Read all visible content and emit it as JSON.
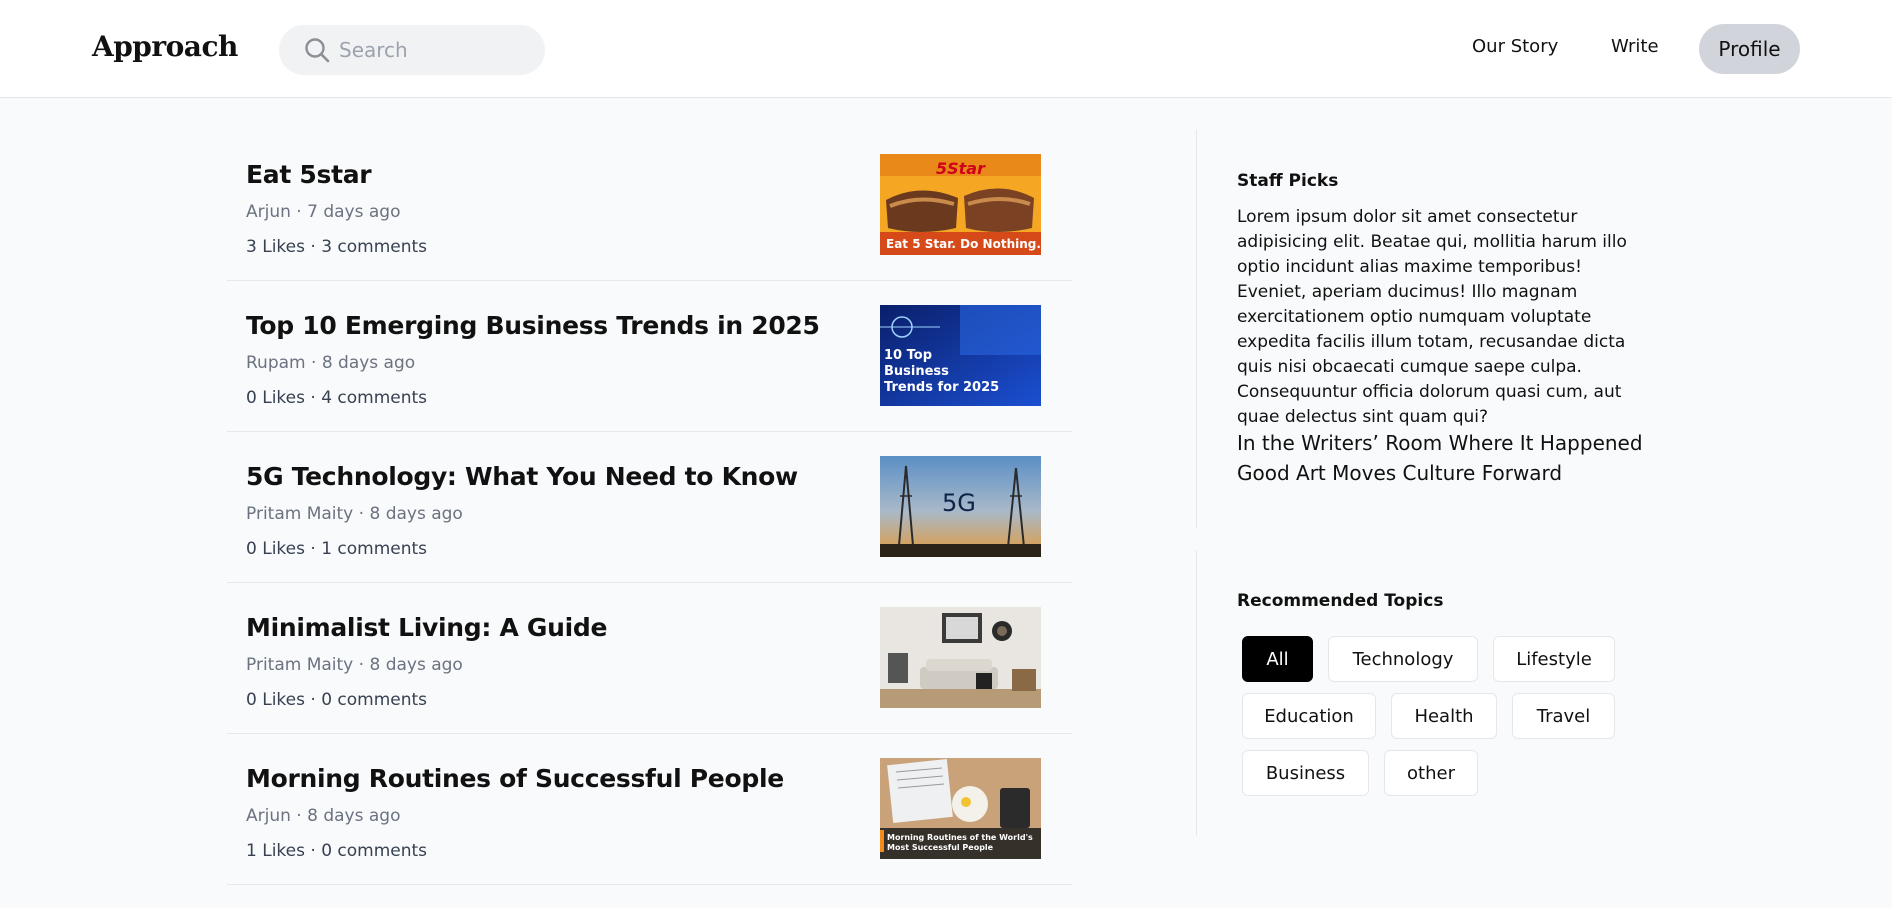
{
  "header": {
    "logo": "Approach",
    "search_placeholder": "Search",
    "nav": {
      "our_story": "Our Story",
      "write": "Write",
      "profile": "Profile"
    }
  },
  "articles": [
    {
      "title": "Eat 5star",
      "author": "Arjun",
      "time": "7 days ago",
      "likes": "3 Likes",
      "comments": "3 comments",
      "thumb_text": [
        "5Star",
        "Eat 5 Star. Do Nothing."
      ]
    },
    {
      "title": "Top 10 Emerging Business Trends in 2025",
      "author": "Rupam",
      "time": "8 days ago",
      "likes": "0 Likes",
      "comments": "4 comments",
      "thumb_text": [
        "10 Top",
        "Business",
        "Trends for 2025"
      ]
    },
    {
      "title": "5G Technology: What You Need to Know",
      "author": "Pritam Maity",
      "time": "8 days ago",
      "likes": "0 Likes",
      "comments": "1 comments",
      "thumb_text": [
        "5G"
      ]
    },
    {
      "title": "Minimalist Living: A Guide",
      "author": "Pritam Maity",
      "time": "8 days ago",
      "likes": "0 Likes",
      "comments": "0 comments",
      "thumb_text": []
    },
    {
      "title": "Morning Routines of Successful People",
      "author": "Arjun",
      "time": "8 days ago",
      "likes": "1 Likes",
      "comments": "0 comments",
      "thumb_text": [
        "Morning Routines of the World's",
        "Most Successful People"
      ]
    }
  ],
  "sidebar": {
    "staff_picks": {
      "heading": "Staff Picks",
      "text": "Lorem ipsum dolor sit amet consectetur adipisicing elit. Beatae qui, mollitia harum illo optio incidunt alias maxime temporibus! Eveniet, aperiam ducimus! Illo magnam exercitationem optio numquam voluptate expedita facilis illum totam, recusandae dicta quis nisi obcaecati cumque saepe culpa. Consequuntur officia dolorum quasi cum, aut quae delectus sint quam qui?",
      "links": [
        "In the Writers’ Room Where It Happened",
        "Good Art Moves Culture Forward"
      ]
    },
    "recommended_topics": {
      "heading": "Recommended Topics",
      "topics": [
        "All",
        "Technology",
        "Lifestyle",
        "Education",
        "Health",
        "Travel",
        "Business",
        "other"
      ],
      "selected": "All"
    }
  },
  "colors": {
    "page_bg": "#f9fafb",
    "header_bg": "#ffffff",
    "profile_bg": "#d1d5db",
    "search_bg": "#f1f2f4",
    "active_topic": "#000000"
  }
}
